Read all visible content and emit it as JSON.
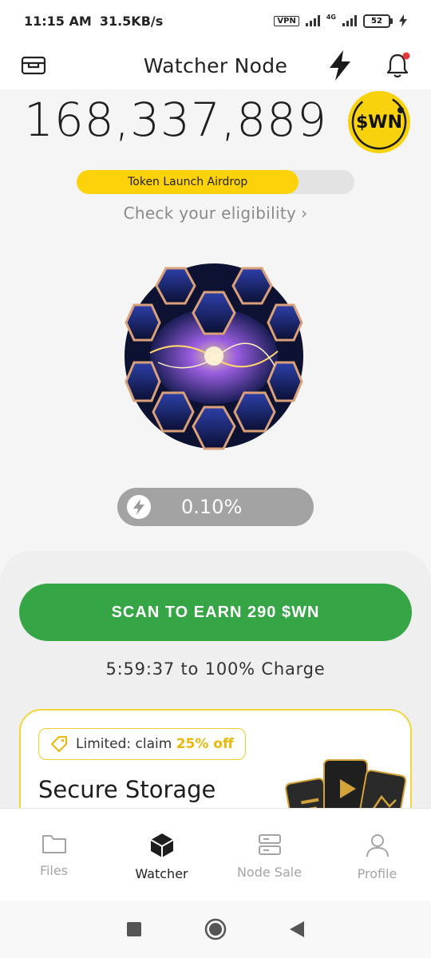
{
  "status_bar": {
    "time": "11:15 AM",
    "speed": "31.5KB/s",
    "vpn": "VPN",
    "network": "4G",
    "battery": "52"
  },
  "header": {
    "title": "Watcher Node",
    "icons": [
      "wallet-icon",
      "lightning-icon",
      "bell-icon"
    ]
  },
  "balance": {
    "amount": "168,337,889",
    "token_badge": "$WN"
  },
  "airdrop": {
    "label": "Token Launch Airdrop",
    "progress": 0.8,
    "eligibility_text": "Check your eligibility"
  },
  "charge": {
    "percent_text": "0.10%",
    "scan_button": "SCAN TO EARN 290 $WN",
    "timer_text": "5:59:37 to 100% Charge"
  },
  "promo": {
    "tag_prefix": "Limited: claim",
    "tag_highlight": "25% off",
    "title": "Secure Storage"
  },
  "bottom_nav": {
    "items": [
      {
        "label": "Files",
        "icon": "folder-icon"
      },
      {
        "label": "Watcher",
        "icon": "cube-icon",
        "active": true
      },
      {
        "label": "Node Sale",
        "icon": "server-icon"
      },
      {
        "label": "Profile",
        "icon": "user-icon"
      }
    ]
  },
  "colors": {
    "accent_yellow": "#fcd20a",
    "scan_green": "#36a546",
    "pill_gray": "#a3a3a3",
    "notification_dot": "#e53935"
  }
}
